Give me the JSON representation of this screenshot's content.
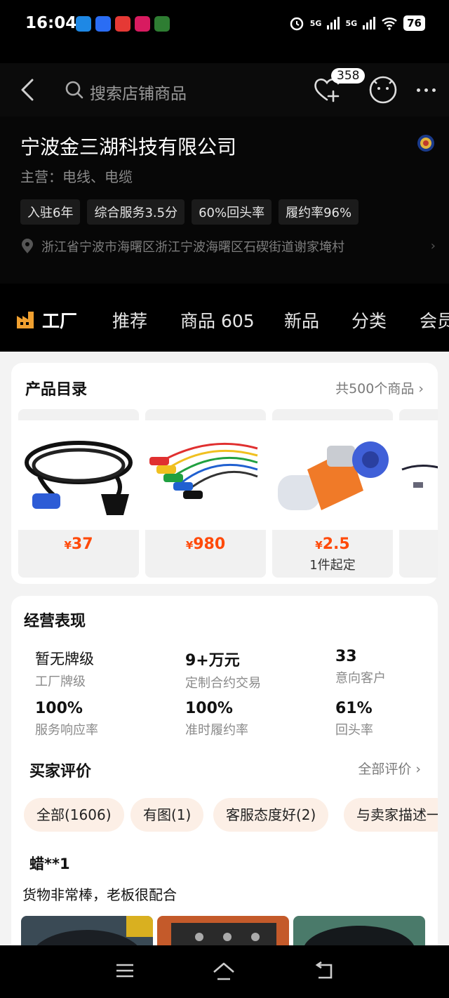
{
  "status_bar": {
    "time": "16:04",
    "battery": "76",
    "signal_1": "5G",
    "signal_2": "5G"
  },
  "header": {
    "search_placeholder": "搜索店铺商品",
    "favorites_count": "358"
  },
  "shop": {
    "name": "宁波金三湖科技有限公司",
    "main_business": "主营：电线、电缆",
    "tags": [
      "入驻6年",
      "综合服务3.5分",
      "60%回头率",
      "履约率96%"
    ],
    "address": "浙江省宁波市海曙区浙江宁波海曙区石碶街道谢家埯村"
  },
  "tabs": [
    "工厂",
    "推荐",
    "商品 605",
    "新品",
    "分类",
    "会员"
  ],
  "catalog": {
    "title": "产品目录",
    "link": "共500个商品",
    "products": [
      {
        "currency": "¥",
        "price": "37",
        "moq": ""
      },
      {
        "currency": "¥",
        "price": "980",
        "moq": ""
      },
      {
        "currency": "¥",
        "price": "2.5",
        "moq": "1件起定"
      }
    ]
  },
  "performance": {
    "title": "经营表现",
    "stats": [
      {
        "value": "暂无牌级",
        "label": "工厂牌级"
      },
      {
        "value": "9+万元",
        "label": "定制合约交易"
      },
      {
        "value": "33",
        "label": "意向客户"
      },
      {
        "value": "100%",
        "label": "服务响应率"
      },
      {
        "value": "100%",
        "label": "准时履约率"
      },
      {
        "value": "61%",
        "label": "回头率"
      }
    ]
  },
  "reviews": {
    "title": "买家评价",
    "link": "全部评价",
    "chips": [
      "全部(1606)",
      "有图(1)",
      "客服态度好(2)",
      "与卖家描述一"
    ],
    "reviewer": "蜡**1",
    "text": "货物非常棒，老板很配合"
  },
  "colors": {
    "price": "#ff4a0a",
    "chip_bg": "#fcefe6",
    "header_bg": "#070707"
  }
}
